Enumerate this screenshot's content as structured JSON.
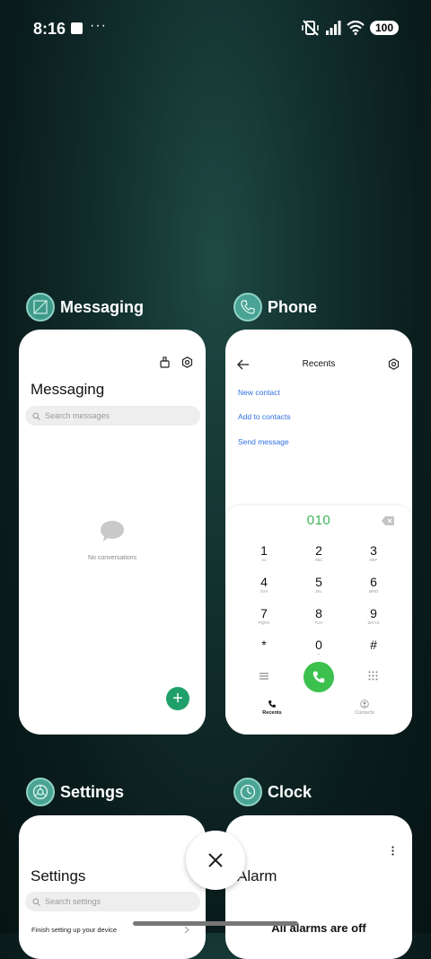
{
  "status_bar": {
    "time": "8:16",
    "dots": "···",
    "battery": "100",
    "icons": [
      "mute-vibrate-icon",
      "signal-icon",
      "wifi-icon",
      "battery-icon"
    ]
  },
  "apps": {
    "messaging": {
      "name": "Messaging",
      "screen_title": "Messaging",
      "search_placeholder": "Search messages",
      "empty_text": "No conversations",
      "fab_label": "+"
    },
    "phone": {
      "name": "Phone",
      "screen_title": "Recents",
      "links": [
        "New contact",
        "Add to contacts",
        "Send message"
      ],
      "dialed_number": "010",
      "keys": [
        {
          "d": "1",
          "l": "oo"
        },
        {
          "d": "2",
          "l": "ABC"
        },
        {
          "d": "3",
          "l": "DEF"
        },
        {
          "d": "4",
          "l": "GHI"
        },
        {
          "d": "5",
          "l": "JKL"
        },
        {
          "d": "6",
          "l": "MNO"
        },
        {
          "d": "7",
          "l": "PQRS"
        },
        {
          "d": "8",
          "l": "TUV"
        },
        {
          "d": "9",
          "l": "WXYZ"
        },
        {
          "d": "*",
          "l": ","
        },
        {
          "d": "0",
          "l": "+"
        },
        {
          "d": "#",
          "l": ""
        }
      ],
      "tab_recents": "Recents",
      "tab_contacts": "Contacts"
    },
    "settings": {
      "name": "Settings",
      "screen_title": "Settings",
      "search_placeholder": "Search settings",
      "first_item": "Finish setting up your device"
    },
    "clock": {
      "name": "Clock",
      "screen_title": "Alarm",
      "status_text": "All alarms are off"
    }
  },
  "colors": {
    "accent_green": "#3cc04e",
    "link_blue": "#2f6fe0",
    "fab_green": "#1fa06a"
  }
}
